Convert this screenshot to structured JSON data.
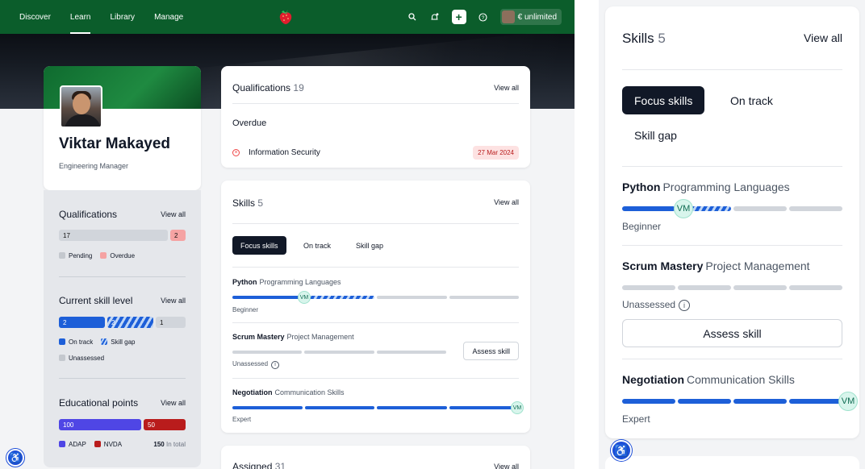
{
  "nav": {
    "items": [
      {
        "label": "Discover",
        "active": false
      },
      {
        "label": "Learn",
        "active": true
      },
      {
        "label": "Library",
        "active": false
      },
      {
        "label": "Manage",
        "active": false
      }
    ],
    "plan_label": "€ unlimited"
  },
  "profile": {
    "name": "Viktar Makayed",
    "role": "Engineering Manager"
  },
  "sidebar": {
    "qualifications": {
      "title": "Qualifications",
      "view_all": "View all",
      "pending_value": "17",
      "overdue_value": "2",
      "legend_pending": "Pending",
      "legend_overdue": "Overdue"
    },
    "skill_level": {
      "title": "Current skill level",
      "view_all": "View all",
      "on_track_value": "2",
      "skill_gap_value": "2",
      "unassessed_value": "1",
      "legend_on_track": "On track",
      "legend_skill_gap": "Skill gap",
      "legend_unassessed": "Unassessed"
    },
    "edu_points": {
      "title": "Educational points",
      "view_all": "View all",
      "adap_value": "100",
      "nvda_value": "50",
      "legend_adap": "ADAP",
      "legend_nvda": "NVDA",
      "total_value": "150",
      "total_suffix": "In total"
    }
  },
  "qualifications_card": {
    "title": "Qualifications",
    "count": "19",
    "view_all": "View all",
    "overdue_heading": "Overdue",
    "item_name": "Information Security",
    "item_date": "27 Mar 2024"
  },
  "skills_card": {
    "title": "Skills",
    "count": "5",
    "view_all": "View all",
    "tabs": [
      "Focus skills",
      "On track",
      "Skill gap"
    ],
    "skills": [
      {
        "name": "Python",
        "category": "Programming Languages",
        "level": "Beginner",
        "progress": "1 of 4 achieved, 1 gap"
      },
      {
        "name": "Scrum Mastery",
        "category": "Project Management",
        "level": "Unassessed",
        "action": "Assess skill"
      },
      {
        "name": "Negotiation",
        "category": "Communication Skills",
        "level": "Expert",
        "progress": "4 of 4"
      }
    ],
    "avatar_initials": "VM"
  },
  "assigned_card": {
    "title": "Assigned",
    "count": "31",
    "view_all": "View all"
  },
  "colors": {
    "brand_green": "#0b5d2b",
    "on_track_blue": "#1d5fd8",
    "overdue_red": "#ef4444",
    "adap_purple": "#4f46e5",
    "nvda_red": "#b91c1c"
  }
}
